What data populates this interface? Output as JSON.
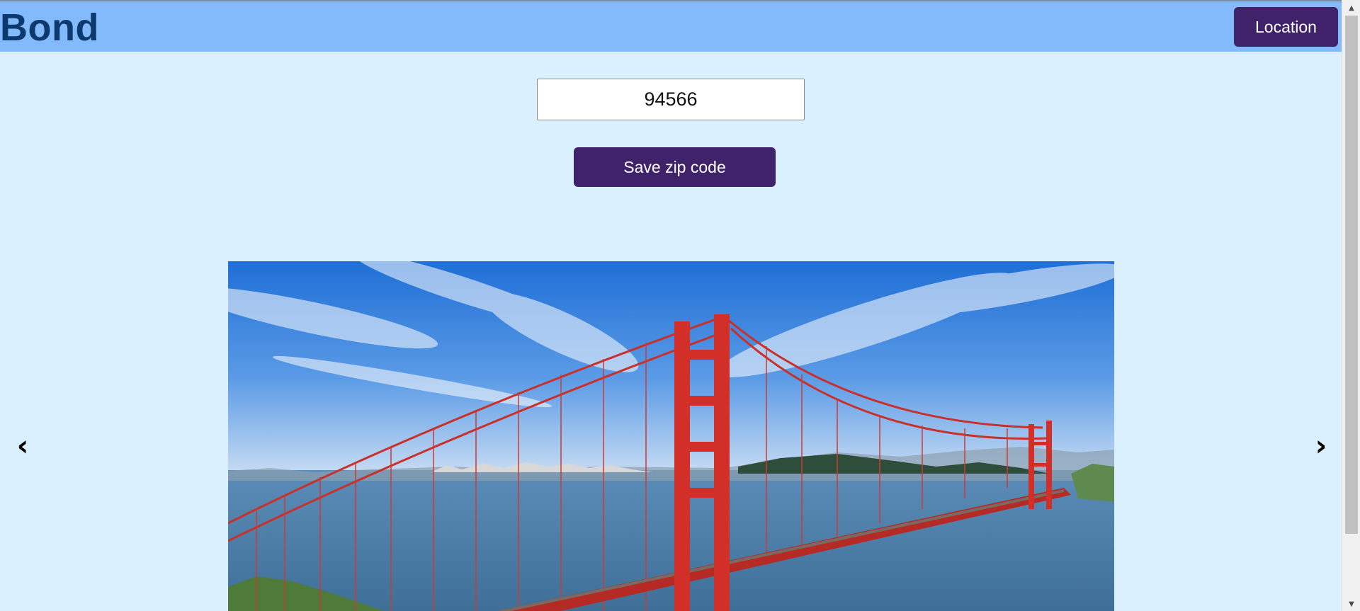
{
  "header": {
    "brand": "Bond",
    "location_label": "Location"
  },
  "zip_form": {
    "value": "94566",
    "save_label": "Save zip code"
  },
  "carousel": {
    "prev_glyph": "‹",
    "next_glyph": "›",
    "slide_image": "golden-gate-bridge-photo"
  },
  "colors": {
    "page_bg": "#daf0fe",
    "header_bg": "#82bafc",
    "brand_text": "#0d3a6e",
    "button_bg": "#3f2269",
    "button_text": "#ffffff"
  }
}
